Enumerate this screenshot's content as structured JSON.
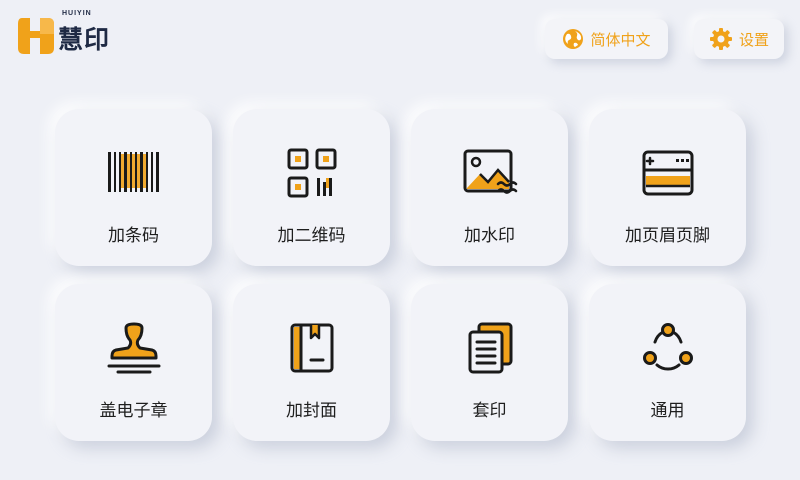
{
  "brand": {
    "sub": "HUIYIN",
    "name": "慧印"
  },
  "topbar": {
    "language_label": "简体中文",
    "settings_label": "设置"
  },
  "colors": {
    "accent": "#f0a21a",
    "dark": "#1f2a44",
    "background": "#eef0f6"
  },
  "tiles": [
    {
      "label": "加条码",
      "icon": "barcode-icon"
    },
    {
      "label": "加二维码",
      "icon": "qrcode-icon"
    },
    {
      "label": "加水印",
      "icon": "watermark-image-icon"
    },
    {
      "label": "加页眉页脚",
      "icon": "header-footer-icon"
    },
    {
      "label": "盖电子章",
      "icon": "stamp-icon"
    },
    {
      "label": "加封面",
      "icon": "book-cover-icon"
    },
    {
      "label": "套印",
      "icon": "overprint-documents-icon"
    },
    {
      "label": "通用",
      "icon": "share-nodes-icon"
    }
  ]
}
